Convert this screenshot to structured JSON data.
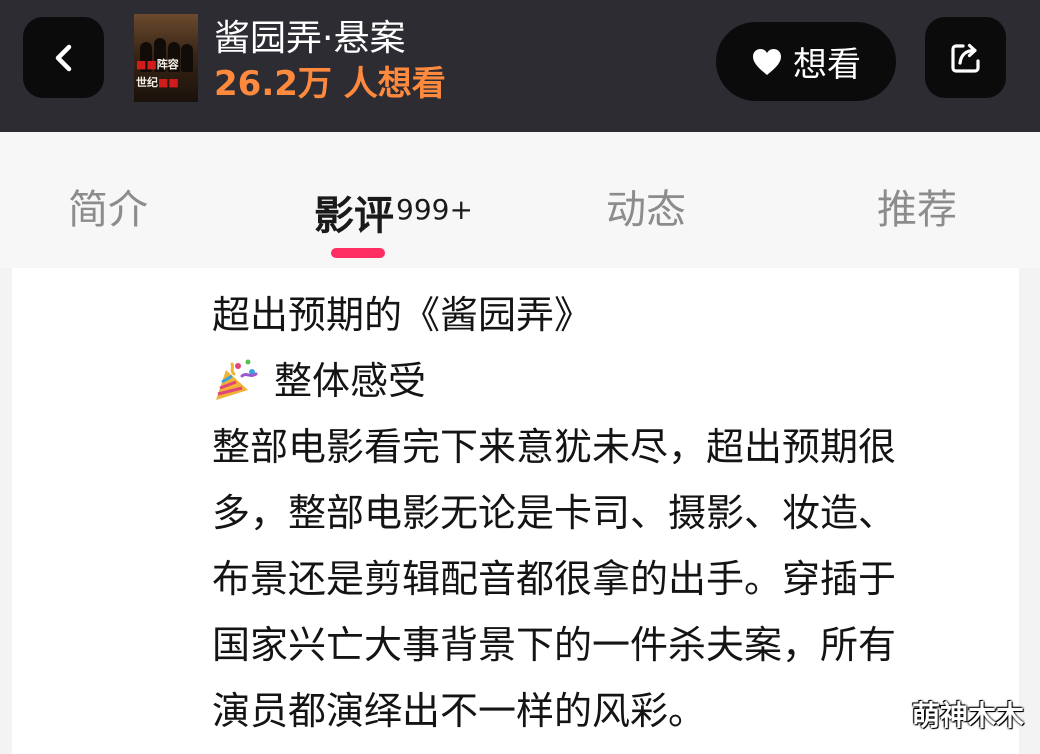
{
  "header": {
    "movie_title": "酱园弄·悬案",
    "want_count": "26.2万 人想看",
    "want_button_label": "想看",
    "poster_text_top": [
      "阵容"
    ],
    "poster_text_bottom": [
      "世纪"
    ]
  },
  "tabs": [
    {
      "label": "简介"
    },
    {
      "label": "影评",
      "badge": "999+",
      "active": true
    },
    {
      "label": "动态"
    },
    {
      "label": "推荐"
    }
  ],
  "review": {
    "title": "超出预期的《酱园弄》",
    "section_heading": "整体感受",
    "section_icon": "party-popper-icon",
    "body_lines": [
      "整部电影看完下来意犹未尽，超出预期很",
      "多，整部电影无论是卡司、摄影、妆造、",
      "布景还是剪辑配音都很拿的出手。穿插于",
      "国家兴亡大事背景下的一件杀夫案，所有",
      "演员都演绎出不一样的风彩。"
    ]
  },
  "watermark": "萌神木木",
  "colors": {
    "header_bg": "#2d2c33",
    "want_count": "#ff8a3d",
    "tab_indicator": "#ff2e62",
    "button_bg": "#0b0b0c"
  }
}
